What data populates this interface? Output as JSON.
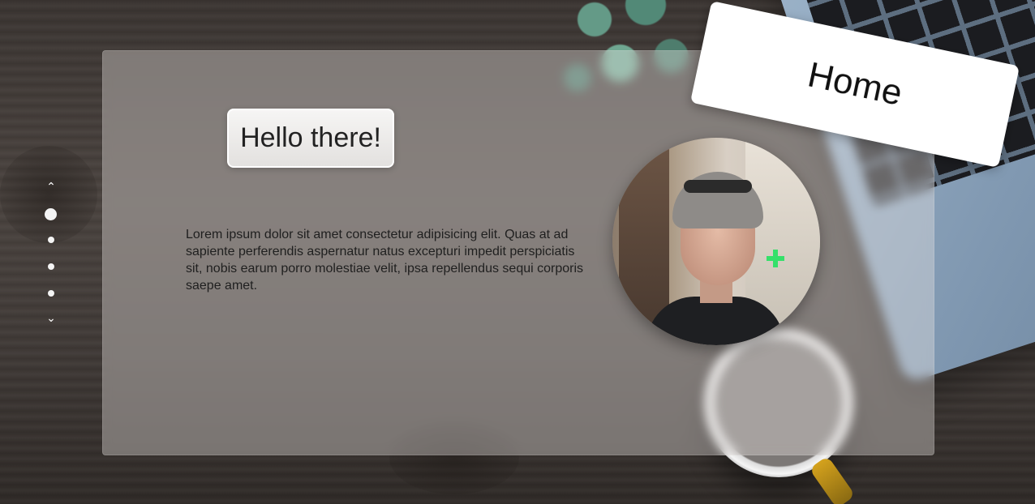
{
  "page": {
    "greeting": "Hello there!",
    "body_text": "Lorem ipsum dolor sit amet consectetur adipisicing elit. Quas at ad sapiente perferendis aspernatur natus excepturi impedit perspiciatis sit, nobis earum porro molestiae velit, ipsa repellendus sequi corporis saepe amet.",
    "nav_label": "Home"
  },
  "side_nav": {
    "up_icon": "chevron-up-icon",
    "down_icon": "chevron-down-icon",
    "up_glyph": "⌃",
    "down_glyph": "⌄",
    "dots": [
      {
        "active": true
      },
      {
        "active": false
      },
      {
        "active": false
      },
      {
        "active": false
      }
    ]
  },
  "colors": {
    "card_overlay": "#ebe6e2",
    "text_dark": "#1f1f1f",
    "dot": "#f4f4f4",
    "nav_tag_bg": "#ffffff"
  }
}
